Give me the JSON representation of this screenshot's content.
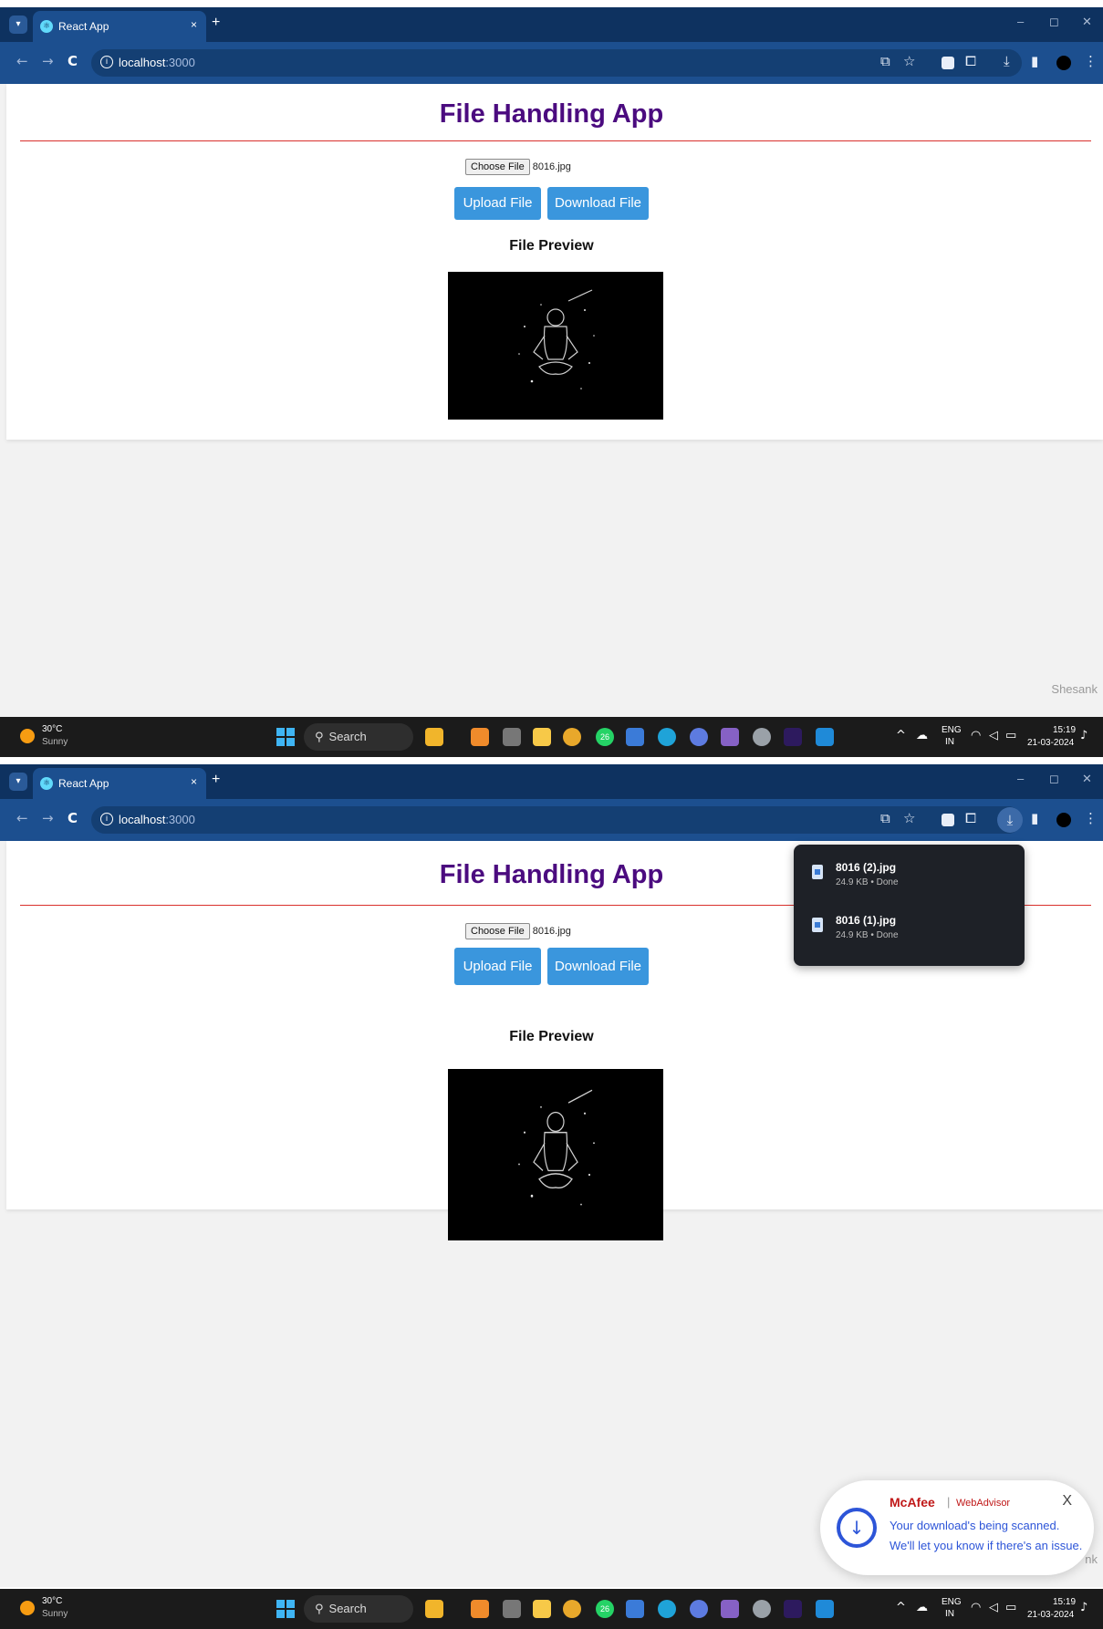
{
  "browser": {
    "tab_title": "React App",
    "tab_close": "×",
    "new_tab": "+",
    "url_host": "localhost",
    "url_port": ":3000",
    "minimize": "–",
    "restore": "◻",
    "close": "✕",
    "back": "←",
    "forward": "→",
    "reload": "C",
    "info": "i"
  },
  "app": {
    "title": "File Handling App",
    "choose_file_label": "Choose File",
    "selected_file": "8016.jpg",
    "upload_label": "Upload File",
    "download_label": "Download File",
    "preview_heading": "File Preview",
    "watermark": "Shesank",
    "watermark_partial": "nk"
  },
  "taskbar": {
    "temperature": "30°C",
    "condition": "Sunny",
    "search_label": "Search",
    "lang_top": "ENG",
    "lang_bottom": "IN",
    "time": "15:19",
    "date": "21-03-2024",
    "badge": "26"
  },
  "downloads": [
    {
      "name": "8016 (2).jpg",
      "meta": "24.9 KB • Done"
    },
    {
      "name": "8016 (1).jpg",
      "meta": "24.9 KB • Done"
    }
  ],
  "mcafee": {
    "brand": "McAfee",
    "separator": "|",
    "product": "WebAdvisor",
    "line1": "Your download's being scanned.",
    "line2": "We'll let you know if there's an issue.",
    "close": "X"
  },
  "colors": {
    "title_purple": "#4b0b7f",
    "rule_red": "#d9302c",
    "button_blue": "#3a96dd",
    "chrome_dark": "#0e3260",
    "chrome_bar": "#1c4f8f"
  }
}
